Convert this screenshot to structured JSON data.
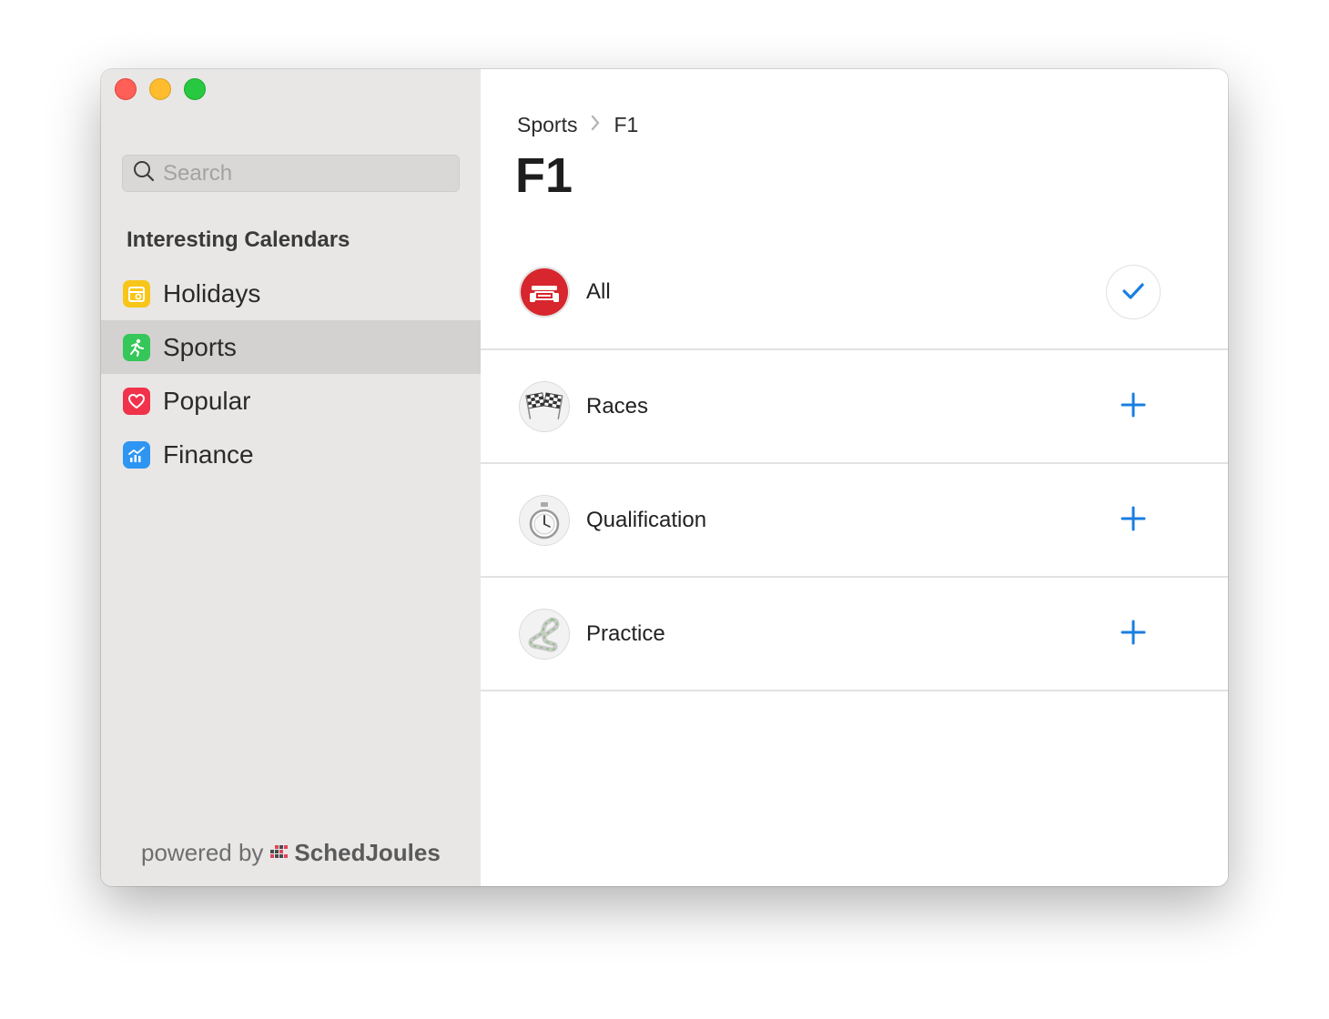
{
  "sidebar": {
    "search": {
      "placeholder": "Search",
      "value": ""
    },
    "section_title": "Interesting Calendars",
    "items": [
      {
        "label": "Holidays",
        "icon": "holidays-icon",
        "color": "#f8c618",
        "active": false
      },
      {
        "label": "Sports",
        "icon": "sports-icon",
        "color": "#35c759",
        "active": true
      },
      {
        "label": "Popular",
        "icon": "popular-icon",
        "color": "#f0324b",
        "active": false
      },
      {
        "label": "Finance",
        "icon": "finance-icon",
        "color": "#2f95f2",
        "active": false
      }
    ],
    "footer": {
      "prefix": "powered by",
      "brand": "SchedJoules"
    }
  },
  "main": {
    "breadcrumb": {
      "parent": "Sports",
      "current": "F1"
    },
    "title": "F1",
    "rows": [
      {
        "label": "All",
        "icon": "f1-car-icon",
        "action": "check-icon",
        "subscribed": true
      },
      {
        "label": "Races",
        "icon": "checkered-flags-icon",
        "action": "plus-icon",
        "subscribed": false
      },
      {
        "label": "Qualification",
        "icon": "stopwatch-icon",
        "action": "plus-icon",
        "subscribed": false
      },
      {
        "label": "Practice",
        "icon": "race-track-icon",
        "action": "plus-icon",
        "subscribed": false
      }
    ]
  },
  "colors": {
    "accent": "#1a7ee0",
    "sidebar_bg": "#e8e7e6",
    "sidebar_active": "#d3d2d1"
  }
}
